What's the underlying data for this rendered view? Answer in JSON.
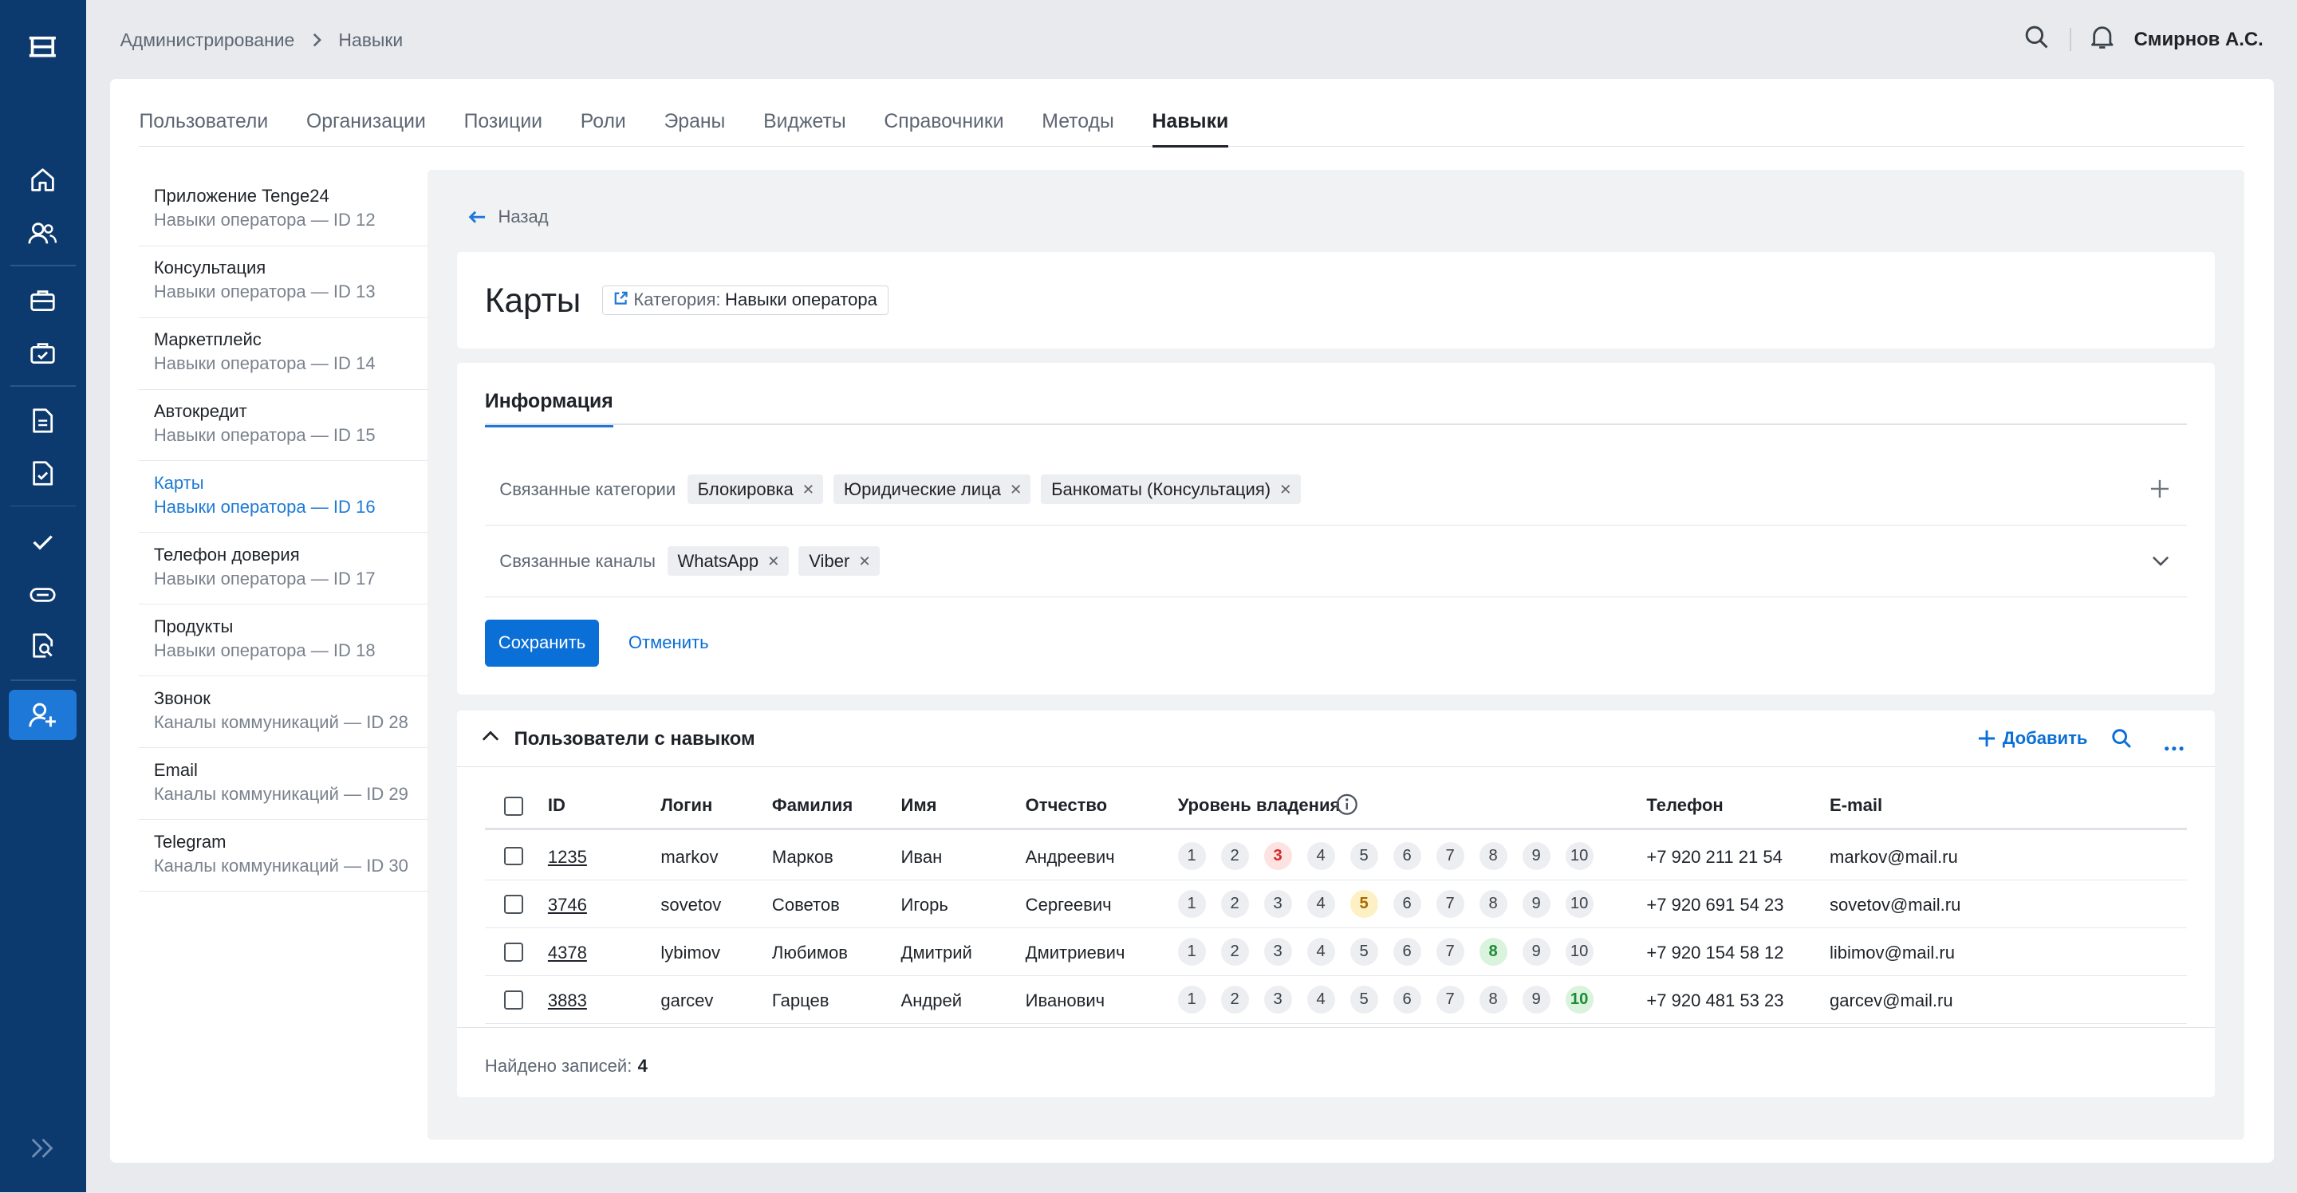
{
  "breadcrumb": [
    "Администрирование",
    "Навыки"
  ],
  "user_name": "Смирнов А.С.",
  "tabs": [
    {
      "label": "Пользователи",
      "active": false
    },
    {
      "label": "Организации",
      "active": false
    },
    {
      "label": "Позиции",
      "active": false
    },
    {
      "label": "Роли",
      "active": false
    },
    {
      "label": "Эраны",
      "active": false
    },
    {
      "label": "Виджеты",
      "active": false
    },
    {
      "label": "Справочники",
      "active": false
    },
    {
      "label": "Методы",
      "active": false
    },
    {
      "label": "Навыки",
      "active": true
    }
  ],
  "skills": [
    {
      "title": "Приложение Tenge24",
      "sub": "Навыки оператора — ID 12",
      "active": false
    },
    {
      "title": "Консультация",
      "sub": "Навыки оператора — ID 13",
      "active": false
    },
    {
      "title": "Маркетплейс",
      "sub": "Навыки оператора — ID 14",
      "active": false
    },
    {
      "title": "Автокредит",
      "sub": "Навыки оператора — ID 15",
      "active": false
    },
    {
      "title": "Карты",
      "sub": "Навыки оператора — ID 16",
      "active": true
    },
    {
      "title": "Телефон доверия",
      "sub": "Навыки оператора — ID 17",
      "active": false
    },
    {
      "title": "Продукты",
      "sub": "Навыки оператора — ID 18",
      "active": false
    },
    {
      "title": "Звонок",
      "sub": "Каналы коммуникаций — ID 28",
      "active": false
    },
    {
      "title": "Email",
      "sub": "Каналы коммуникаций — ID 29",
      "active": false
    },
    {
      "title": "Telegram",
      "sub": "Каналы коммуникаций — ID 30",
      "active": false
    }
  ],
  "back_label": "Назад",
  "page_title": "Карты",
  "category": {
    "key": "Категория:",
    "value": "Навыки оператора"
  },
  "info_tab": "Информация",
  "related_categories": {
    "label": "Связанные категории",
    "chips": [
      "Блокировка",
      "Юридические лица",
      "Банкоматы (Консультация)"
    ]
  },
  "related_channels": {
    "label": "Связанные каналы",
    "chips": [
      "WhatsApp",
      "Viber"
    ]
  },
  "save_label": "Сохранить",
  "cancel_label": "Отменить",
  "users_section": {
    "title": "Пользователи с навыком",
    "add_label": "Добавить",
    "columns": [
      "ID",
      "Логин",
      "Фамилия",
      "Имя",
      "Отчество",
      "Уровень владения",
      "Телефон",
      "E-mail"
    ],
    "levels": [
      "1",
      "2",
      "3",
      "4",
      "5",
      "6",
      "7",
      "8",
      "9",
      "10"
    ],
    "rows": [
      {
        "id": "1235",
        "login": "markov",
        "last": "Марков",
        "first": "Иван",
        "middle": "Андреевич",
        "level": 3,
        "level_color": "#d42a2a",
        "phone": "+7 920 211 21 54",
        "email": "markov@mail.ru"
      },
      {
        "id": "3746",
        "login": "sovetov",
        "last": "Советов",
        "first": "Игорь",
        "middle": "Сергеевич",
        "level": 5,
        "level_color": "#a66a00",
        "phone": "+7 920 691 54 23",
        "email": "sovetov@mail.ru"
      },
      {
        "id": "4378",
        "login": "lybimov",
        "last": "Любимов",
        "first": "Дмитрий",
        "middle": "Дмитриевич",
        "level": 8,
        "level_color": "#1f8a36",
        "phone": "+7 920 154 58 12",
        "email": "libimov@mail.ru"
      },
      {
        "id": "3883",
        "login": "garcev",
        "last": "Гарцев",
        "first": "Андрей",
        "middle": "Иванович",
        "level": 10,
        "level_color": "#1f8a36",
        "phone": "+7 920 481 53 23",
        "email": "garcev@mail.ru"
      }
    ],
    "found_label": "Найдено записей:",
    "found_count": "4"
  },
  "colors": {
    "rail": "#0d3a6e",
    "accent": "#0a6fd6",
    "active_nav": "#1e78d8"
  }
}
